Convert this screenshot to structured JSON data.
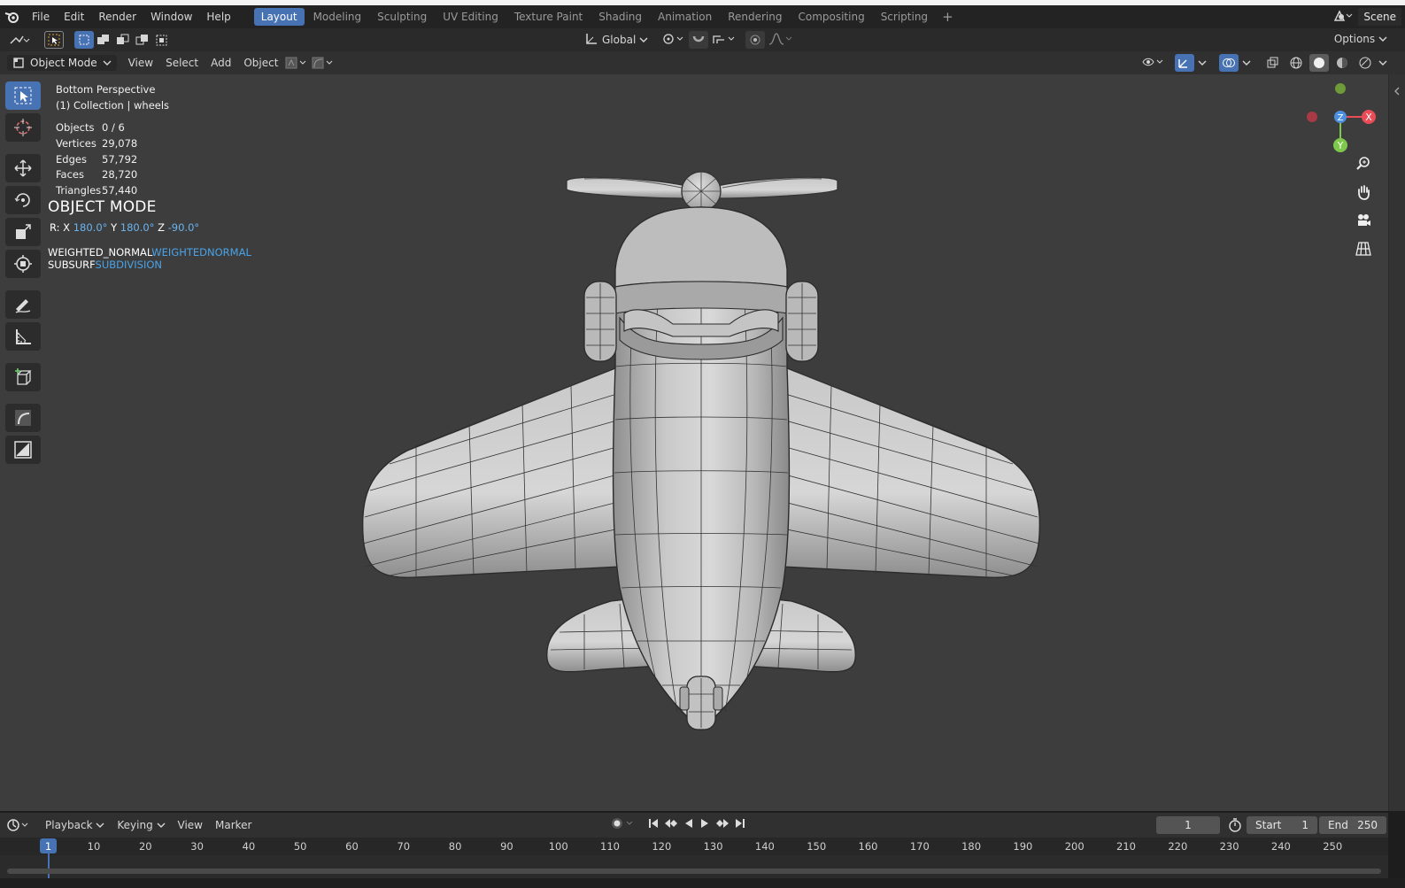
{
  "menubar": {
    "items": [
      "File",
      "Edit",
      "Render",
      "Window",
      "Help"
    ],
    "workspaces": [
      "Layout",
      "Modeling",
      "Sculpting",
      "UV Editing",
      "Texture Paint",
      "Shading",
      "Animation",
      "Rendering",
      "Compositing",
      "Scripting"
    ],
    "active_workspace": "Layout",
    "add_symbol": "+",
    "scene": "Scene"
  },
  "toolheader": {
    "orientation": "Global",
    "options": "Options"
  },
  "viewport_header": {
    "mode": "Object Mode",
    "menus": [
      "View",
      "Select",
      "Add",
      "Object"
    ]
  },
  "overlay": {
    "view_name": "Bottom Perspective",
    "collection": "(1) Collection | wheels",
    "stats": [
      {
        "label": "Objects",
        "value": "0 / 6"
      },
      {
        "label": "Vertices",
        "value": "29,078"
      },
      {
        "label": "Edges",
        "value": "57,792"
      },
      {
        "label": "Faces",
        "value": "28,720"
      },
      {
        "label": "Triangles",
        "value": "57,440"
      }
    ],
    "mode_title": "OBJECT MODE",
    "rotation": {
      "prefix": "R:",
      "x_label": "X",
      "x": "180.0°",
      "y_label": "Y",
      "y": "180.0°",
      "z_label": "Z",
      "z": "-90.0°"
    },
    "modifiers": [
      {
        "name": "WEIGHTED_NORMAL",
        "type": "WEIGHTEDNORMAL"
      },
      {
        "name": "SUBSURF",
        "type": "SUBDIVISION"
      }
    ]
  },
  "gizmo": {
    "x": "X",
    "y": "Y",
    "z": "Z",
    "colors": {
      "x": "#e94b57",
      "y": "#7ec94b",
      "z": "#4a8fe0"
    }
  },
  "timeline": {
    "menus": [
      "Playback",
      "Keying",
      "View",
      "Marker"
    ],
    "current_frame": "1",
    "start_label": "Start",
    "start": "1",
    "end_label": "End",
    "end": "250",
    "ticks": [
      "10",
      "20",
      "30",
      "40",
      "50",
      "60",
      "70",
      "80",
      "90",
      "100",
      "110",
      "120",
      "130",
      "140",
      "150",
      "160",
      "170",
      "180",
      "190",
      "200",
      "210",
      "220",
      "230",
      "240",
      "250"
    ]
  },
  "colors": {
    "accent": "#4772b3",
    "viewport_bg": "#3d3d3d"
  }
}
